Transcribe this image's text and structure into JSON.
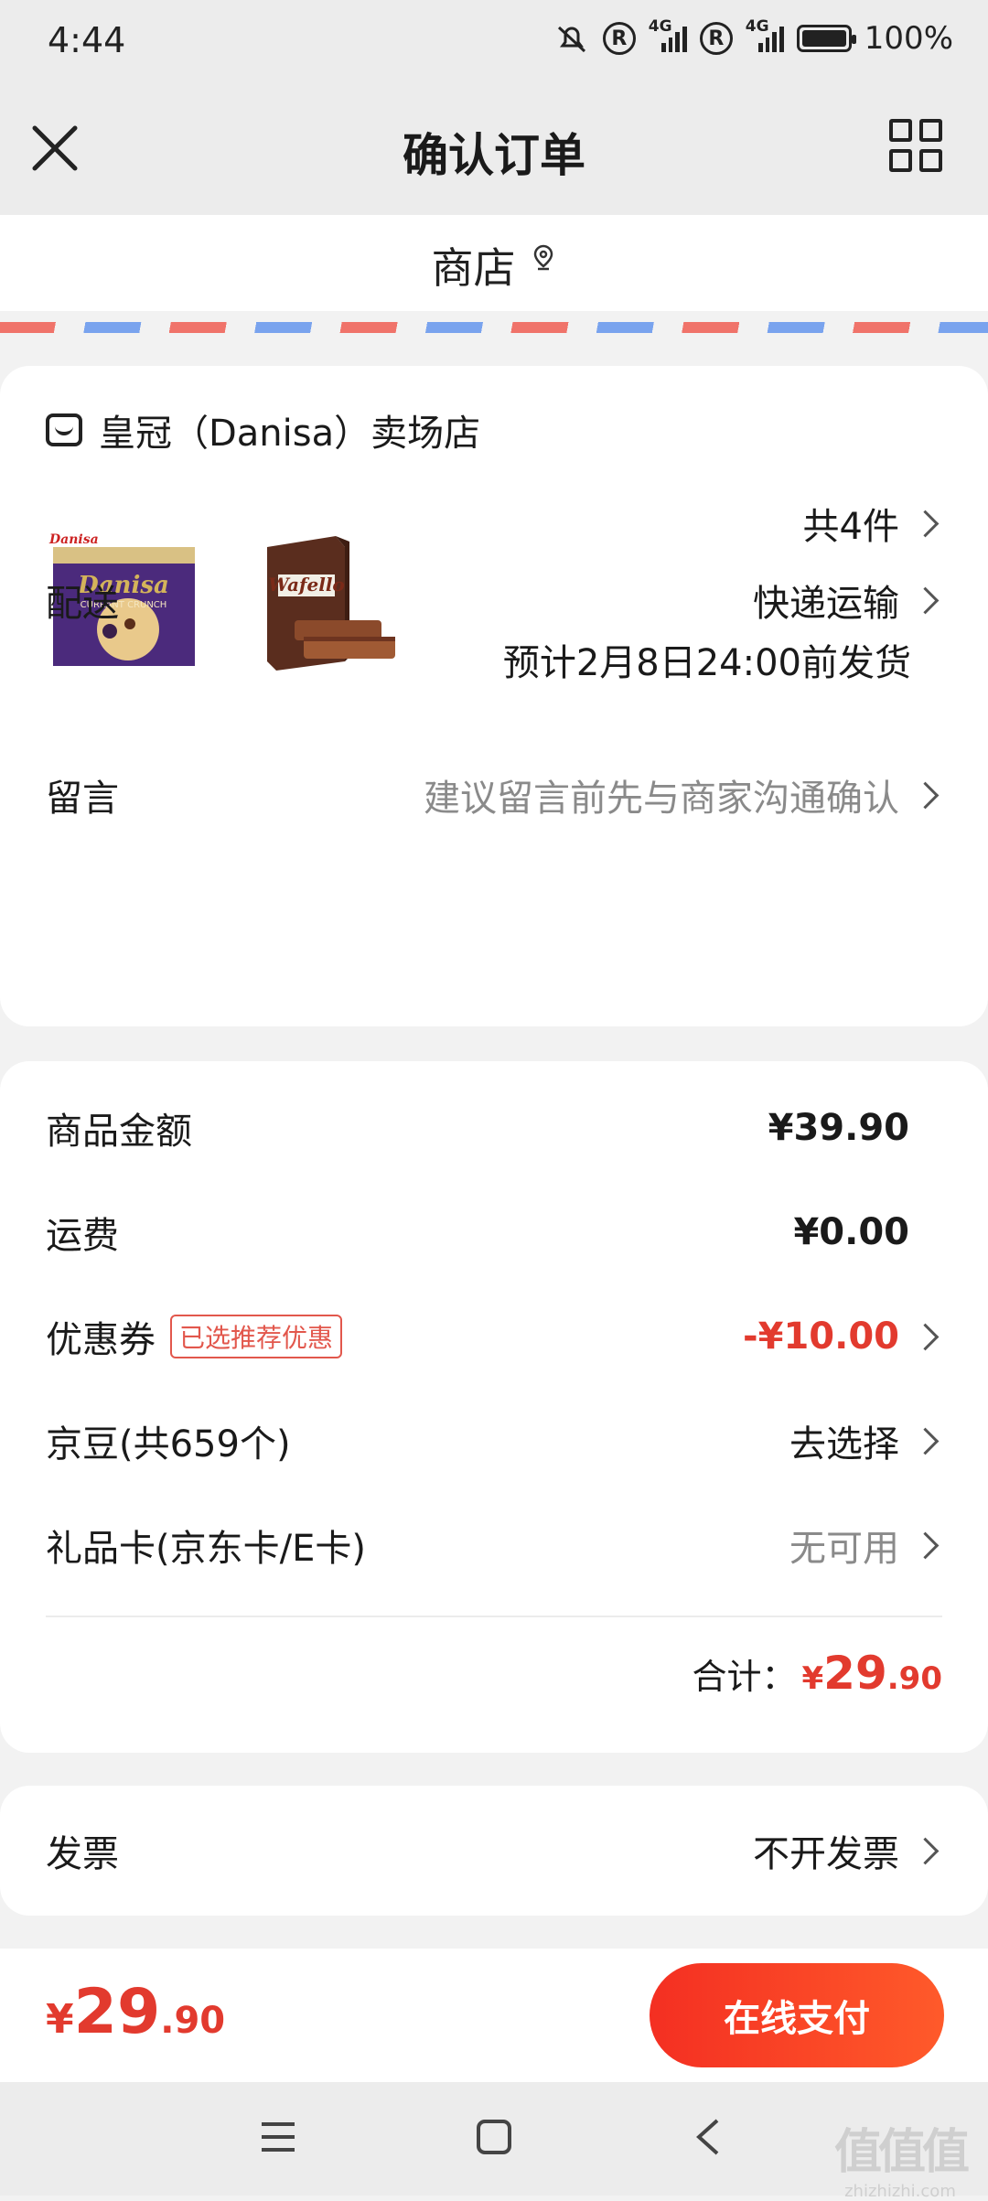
{
  "status": {
    "time": "4:44",
    "net1": "4G",
    "net2": "4G",
    "battery": "100%",
    "battery_level": 1.0
  },
  "nav": {
    "title": "确认订单"
  },
  "store_bar": {
    "label": "商店"
  },
  "shop": {
    "name": "皇冠（Danisa）卖场店"
  },
  "products": {
    "count_label": "共4件",
    "items": [
      {
        "brand": "Danisa",
        "sub": "CURRANT CRUNCH"
      },
      {
        "brand": "Wafello"
      }
    ]
  },
  "delivery": {
    "label": "配送",
    "method": "快递运输",
    "estimate": "预计2月8日24:00前发货"
  },
  "message": {
    "label": "留言",
    "placeholder": "建议留言前先与商家沟通确认"
  },
  "summary": {
    "goods_label": "商品金额",
    "goods_value": "¥39.90",
    "shipping_label": "运费",
    "shipping_value": "¥0.00",
    "coupon_label": "优惠券",
    "coupon_badge": "已选推荐优惠",
    "coupon_value": "-¥10.00",
    "jingdou_label": "京豆(共659个)",
    "jingdou_value": "去选择",
    "giftcard_label": "礼品卡(京东卡/E卡)",
    "giftcard_value": "无可用",
    "total_label": "合计：",
    "total_currency": "¥",
    "total_int": "29",
    "total_dec": ".90"
  },
  "invoice": {
    "label": "发票",
    "value": "不开发票"
  },
  "pay": {
    "currency": "¥",
    "int": "29",
    "dec": ".90",
    "button": "在线支付"
  },
  "watermark": {
    "text": "值值值",
    "sub": "zhizhizhi.com"
  },
  "colors": {
    "accent": "#e23a2e",
    "pay_button": "#f42f22",
    "background": "#f2f2f2"
  }
}
